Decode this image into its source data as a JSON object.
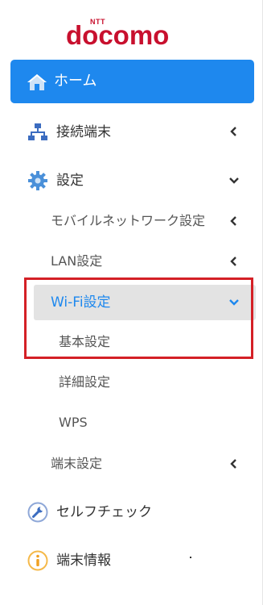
{
  "brand": {
    "ntt": "NTT",
    "name": "docomo"
  },
  "nav": {
    "home": "ホーム",
    "connected_devices": "接続端末",
    "settings": "設定",
    "settings_children": {
      "mobile_network": "モバイルネットワーク設定",
      "lan": "LAN設定",
      "wifi": "Wi-Fi設定",
      "wifi_children": {
        "basic": "基本設定",
        "advanced": "詳細設定",
        "wps": "WPS"
      },
      "device": "端末設定"
    },
    "self_check": "セルフチェック",
    "device_info": "端末情報"
  },
  "colors": {
    "accent": "#1e88ee",
    "brand": "#c8102e",
    "highlight_box": "#d42026",
    "selected_bg": "#e3e3e3"
  },
  "icons": {
    "home": "home-icon",
    "connected_devices": "network-icon",
    "settings": "gear-icon",
    "self_check": "wrench-icon",
    "device_info": "info-icon",
    "expanded": "chevron-down-icon",
    "collapsed": "chevron-left-icon"
  }
}
